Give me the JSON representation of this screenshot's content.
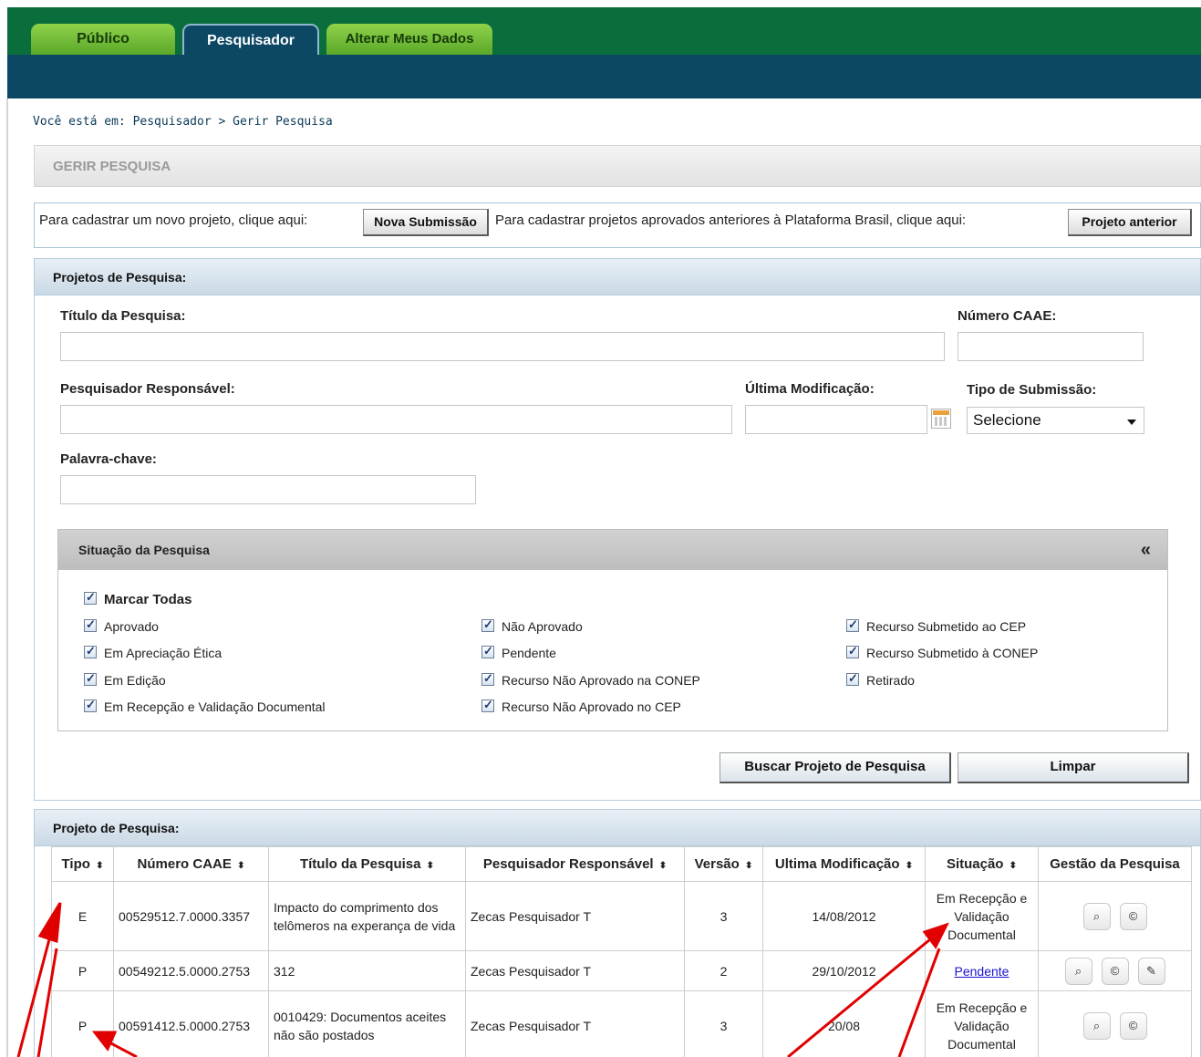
{
  "tabs": {
    "publico": "Público",
    "pesquisador": "Pesquisador",
    "alterar": "Alterar Meus Dados"
  },
  "breadcrumb": "Você está em: Pesquisador > Gerir Pesquisa",
  "page_title": "GERIR PESQUISA",
  "submission": {
    "text1": "Para cadastrar um novo projeto, clique aqui:",
    "btn_nova": "Nova Submissão",
    "text2": "Para cadastrar projetos aprovados anteriores à Plataforma Brasil, clique aqui:",
    "btn_anterior": "Projeto anterior"
  },
  "search": {
    "header": "Projetos de Pesquisa:",
    "titulo_label": "Título da Pesquisa:",
    "caae_label": "Número CAAE:",
    "pesquisador_label": "Pesquisador Responsável:",
    "ultima_label": "Última Modificação:",
    "tipo_label": "Tipo de Submissão:",
    "tipo_value": "Selecione",
    "palavra_label": "Palavra-chave:"
  },
  "situacao": {
    "header": "Situação da Pesquisa",
    "collapse": "«",
    "marcar_todas": "Marcar Todas",
    "col1": [
      "Aprovado",
      "Em Apreciação Ética",
      "Em Edição",
      "Em Recepção e Validação Documental"
    ],
    "col2": [
      "Não Aprovado",
      "Pendente",
      "Recurso Não Aprovado na CONEP",
      "Recurso Não Aprovado no CEP"
    ],
    "col3": [
      "Recurso Submetido ao CEP",
      "Recurso Submetido à CONEP",
      "Retirado"
    ]
  },
  "buttons": {
    "buscar": "Buscar Projeto de Pesquisa",
    "limpar": "Limpar"
  },
  "results": {
    "header": "Projeto de Pesquisa:",
    "columns": [
      "Tipo",
      "Número CAAE",
      "Título da Pesquisa",
      "Pesquisador Responsável",
      "Versão",
      "Ultima Modificação",
      "Situação",
      "Gestão da Pesquisa"
    ],
    "sort_glyph": "⬍",
    "rows": [
      {
        "tipo": "E",
        "caae": "00529512.7.0000.3357",
        "titulo": "Impacto do comprimento dos telômeros na experança de vida",
        "pesquisador": "Zecas Pesquisador T",
        "versao": "3",
        "data": "14/08/2012",
        "situacao": "Em Recepção e Validação Documental"
      },
      {
        "tipo": "P",
        "caae": "00549212.5.0000.2753",
        "titulo": "312",
        "pesquisador": "Zecas Pesquisador T",
        "versao": "2",
        "data": "29/10/2012",
        "situacao": "Pendente"
      },
      {
        "tipo": "P",
        "caae": "00591412.5.0000.2753",
        "titulo": "0010429: Documentos aceites não são postados",
        "pesquisador": "Zecas Pesquisador T",
        "versao": "3",
        "data": "20/08",
        "situacao": "Em Recepção e Validação Documental"
      }
    ]
  },
  "icons": {
    "view": "magnifier-icon",
    "copy": "copy-icon",
    "edit": "pencil-icon"
  },
  "colors": {
    "green_bar": "#0a6e3c",
    "blue_bar": "#0c4764",
    "arrow": "#e00000"
  }
}
